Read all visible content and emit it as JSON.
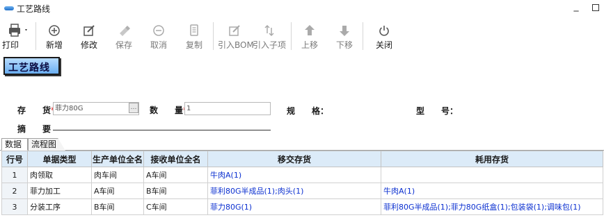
{
  "window": {
    "title": "工艺路线",
    "minimize_glyph": "_"
  },
  "toolbar": {
    "print": {
      "label": "打印",
      "icon": "printer-icon"
    },
    "add": {
      "label": "新增",
      "icon": "plus-circle-icon"
    },
    "edit": {
      "label": "修改",
      "icon": "pencil-box-icon"
    },
    "save": {
      "label": "保存",
      "icon": "eraser-icon"
    },
    "cancel": {
      "label": "取消",
      "icon": "minus-circle-icon"
    },
    "copy": {
      "label": "复制",
      "icon": "document-icon"
    },
    "import_bom": {
      "label": "引入BOM",
      "icon": "pencil-box-icon"
    },
    "import_sub": {
      "label": "引入子项",
      "icon": "sort-arrows-icon"
    },
    "move_up": {
      "label": "上移",
      "icon": "arrow-up-icon"
    },
    "move_down": {
      "label": "下移",
      "icon": "arrow-down-icon"
    },
    "close": {
      "label": "关闭",
      "icon": "power-icon"
    }
  },
  "page_badge": "工艺路线",
  "form": {
    "inventory_label": "存　　货",
    "inventory_value": "菲力80G",
    "browse_glyph": "…",
    "quantity_label": "数　　量",
    "quantity_value": "1",
    "spec_label": "规　　格：",
    "model_label": "型　　号：",
    "summary_label": "摘　　要"
  },
  "tabs": [
    "数据",
    "流程图"
  ],
  "grid": {
    "columns": [
      "行号",
      "单据类型",
      "生产单位全名",
      "接收单位全名",
      "移交存货",
      "耗用存货"
    ],
    "rows": [
      {
        "no": "1",
        "type": "肉领取",
        "producer": "肉车间",
        "receiver": "A车间",
        "transfer": "牛肉A(1)",
        "consume": ""
      },
      {
        "no": "2",
        "type": "菲力加工",
        "producer": "A车间",
        "receiver": "B车间",
        "transfer": "菲利80G半成品(1);肉头(1)",
        "consume": "牛肉A(1)"
      },
      {
        "no": "3",
        "type": "分装工序",
        "producer": "B车间",
        "receiver": "C车间",
        "transfer": "菲力80G(1)",
        "consume": "菲利80G半成品(1);菲力80G纸盒(1);包装袋(1);调味包(1)"
      }
    ]
  },
  "colors": {
    "header_bg": "#dcebf8",
    "badge_bg": "#8ec5f8",
    "link_text": "#0a2fd0",
    "required": "#e00000"
  }
}
